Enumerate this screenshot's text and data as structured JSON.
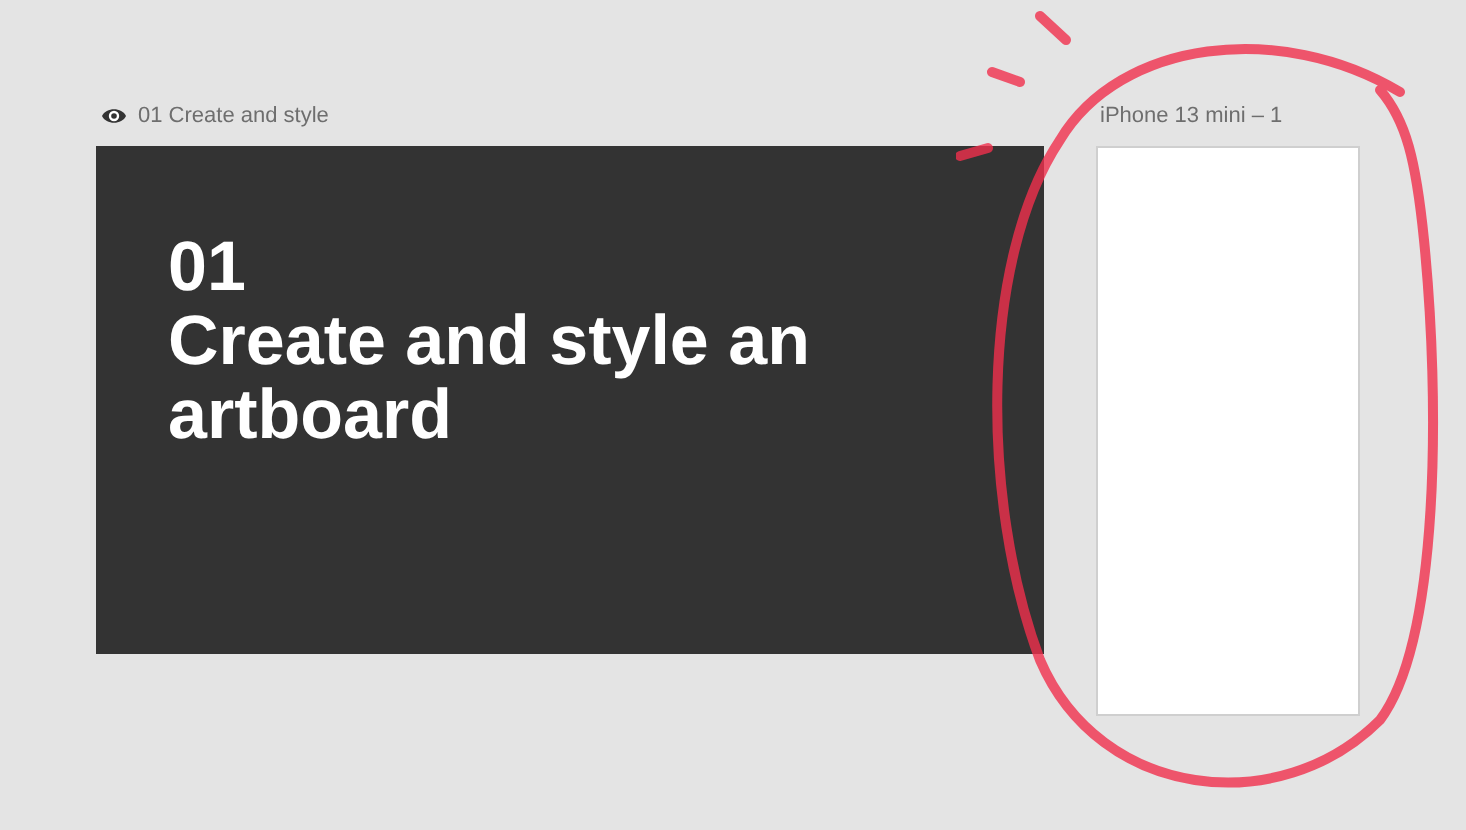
{
  "artboards": [
    {
      "label": "01 Create and style",
      "label_icon": true,
      "kind": "title-card",
      "number": "01",
      "title": "Create and style an artboard"
    },
    {
      "label": "iPhone 13 mini – 1",
      "label_icon": false,
      "kind": "blank"
    }
  ]
}
